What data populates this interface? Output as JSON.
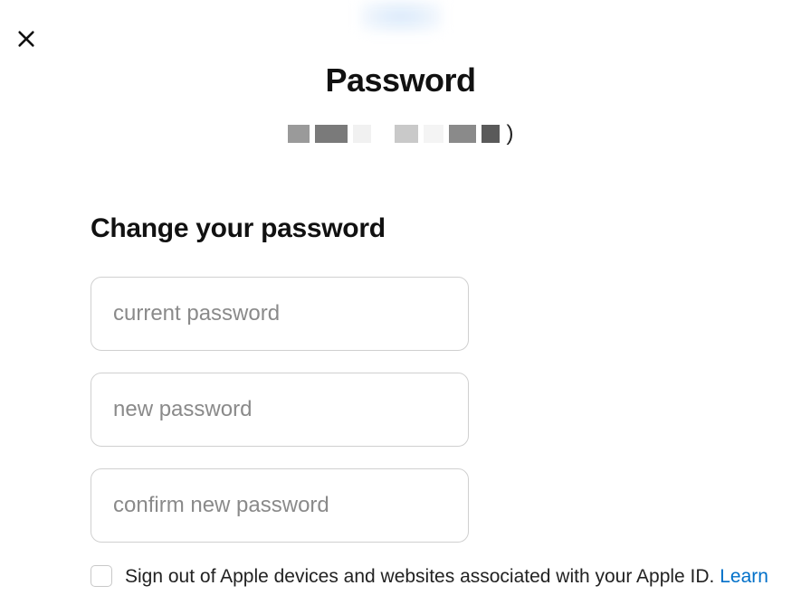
{
  "header": {
    "title": "Password"
  },
  "form": {
    "heading": "Change your password",
    "current_placeholder": "current password",
    "new_placeholder": "new password",
    "confirm_placeholder": "confirm new password",
    "signout_label": "Sign out of Apple devices and websites associated with your Apple ID. ",
    "learn_link": "Learn"
  }
}
